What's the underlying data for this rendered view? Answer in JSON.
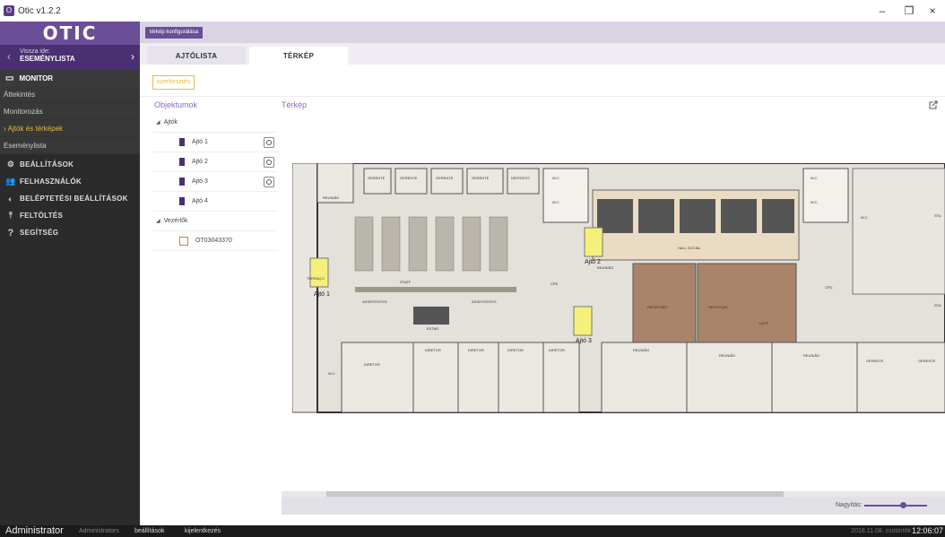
{
  "window": {
    "title": "Otic v1.2.2",
    "controls": [
      "–",
      "❐",
      "×"
    ]
  },
  "sidebar": {
    "logo": "OTIC",
    "back": {
      "label": "Vissza ide:",
      "target": "ESEMÉNYLISTA"
    },
    "monitor_section": "MONITOR",
    "sub_items": [
      "Áttekintés",
      "Monitorozás",
      "Ajtók és térképek",
      "Eseménylista"
    ],
    "active_sub_item": "Ajtók és térképek",
    "main_items": [
      {
        "label": "BEÁLLÍTÁSOK",
        "icon": "gear-icon"
      },
      {
        "label": "FELHASZNÁLÓK",
        "icon": "users-icon"
      },
      {
        "label": "BELÉPTETÉSI BEÁLLÍTÁSOK",
        "icon": "access-icon"
      },
      {
        "label": "FELTÖLTÉS",
        "icon": "upload-icon"
      },
      {
        "label": "SEGÍTSÉG",
        "icon": "help-icon"
      }
    ]
  },
  "header": {
    "config_button": "térkép konfigurálása"
  },
  "tabs": [
    {
      "label": "AJTÓLISTA",
      "active": false
    },
    {
      "label": "TÉRKÉP",
      "active": true
    }
  ],
  "toolbar": {
    "edit_button": "szerkesztés"
  },
  "objects": {
    "title": "Objektumok",
    "groups": [
      {
        "label": "Ajtók",
        "items": [
          {
            "label": "Ajtó 1",
            "fingerprint": true
          },
          {
            "label": "Ajtó 2",
            "fingerprint": true
          },
          {
            "label": "Ajtó 3",
            "fingerprint": true
          },
          {
            "label": "Ajtó 4",
            "fingerprint": false
          }
        ]
      },
      {
        "label": "Vezérlők",
        "items": [
          {
            "label": "OT03043370"
          }
        ]
      }
    ]
  },
  "map": {
    "title": "Térkép",
    "doors": [
      "Ajtó 1",
      "Ajtó 2",
      "Ajtó 3"
    ],
    "room_labels": [
      "REUNIÃO",
      "GERENTE",
      "GERENTE",
      "GERENTE",
      "GERENTE",
      "DEPÓSITO",
      "W.C.",
      "W.C.",
      "W.C.",
      "W.C.",
      "HALL SOCIAL",
      "STAFF",
      "ASSISTENTES",
      "ASSISTENTES",
      "ESTAR",
      "CPD",
      "REUNIÃO",
      "RECEPÇÃO",
      "RECEPÇÃO",
      "CAFÉ",
      "CPD",
      "DIRETOR",
      "DIRETOR",
      "DIRETOR",
      "DIRETOR",
      "DIRETOR",
      "REUNIÃO",
      "REUNIÃO",
      "REUNIÃO",
      "GERENTE",
      "GERENTE",
      "TERRAÇO",
      "W.C.",
      "W.C.",
      "STA",
      "STA"
    ],
    "zoom_label": "Nagyítás:"
  },
  "status": {
    "user": "Administrator",
    "role": "Administrators",
    "links": [
      "beállítások",
      "kijelentkezés"
    ],
    "date": "2018.11.08. csütörtök",
    "time": "12:06:07"
  },
  "colors": {
    "accent": "#6a4e97",
    "sidebar": "#2b2b2b",
    "highlight": "#e2b84a",
    "door": "#f5f07a"
  }
}
